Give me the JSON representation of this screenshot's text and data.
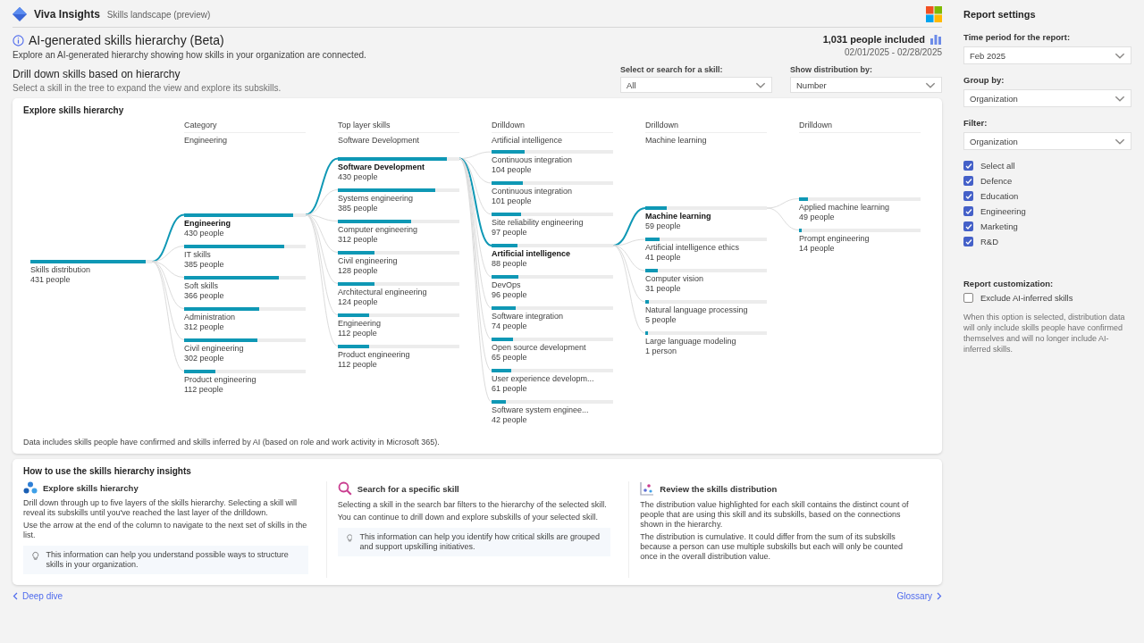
{
  "header": {
    "app_name": "Viva Insights",
    "page": "Skills landscape (preview)"
  },
  "title": "AI-generated skills hierarchy (Beta)",
  "description": "Explore an AI-generated hierarchy showing how skills in your organization are connected.",
  "people_included": "1,031 people included",
  "date_range": "02/01/2025 - 02/28/2025",
  "drilldown": {
    "title": "Drill down skills based on hierarchy",
    "hint": "Select a skill in the tree to expand the view and explore its subskills."
  },
  "filters": [
    {
      "label": "Select or search for a skill:",
      "value": "All"
    },
    {
      "label": "Show distribution by:",
      "value": "Number"
    }
  ],
  "hierarchy": {
    "title": "Explore skills hierarchy",
    "root": {
      "label": "Skills distribution",
      "count": "431 people",
      "level": 0.95
    },
    "columns": [
      {
        "header": "Category",
        "selection": "Engineering",
        "items": [
          {
            "label": "Engineering",
            "count": "430 people",
            "level": 0.9,
            "selected": true
          },
          {
            "label": "IT skills",
            "count": "385 people",
            "level": 0.82,
            "selected": false
          },
          {
            "label": "Soft skills",
            "count": "366 people",
            "level": 0.78,
            "selected": false
          },
          {
            "label": "Administration",
            "count": "312 people",
            "level": 0.62,
            "selected": false
          },
          {
            "label": "Civil engineering",
            "count": "302 people",
            "level": 0.6,
            "selected": false
          },
          {
            "label": "Product engineering",
            "count": "112 people",
            "level": 0.26,
            "selected": false
          }
        ]
      },
      {
        "header": "Top layer skills",
        "selection": "Software Development",
        "items": [
          {
            "label": "Software Development",
            "count": "430 people",
            "level": 0.9,
            "selected": true
          },
          {
            "label": "Systems engineering",
            "count": "385 people",
            "level": 0.8,
            "selected": false
          },
          {
            "label": "Computer engineering",
            "count": "312 people",
            "level": 0.6,
            "selected": false
          },
          {
            "label": "Civil engineering",
            "count": "128 people",
            "level": 0.3,
            "selected": false
          },
          {
            "label": "Architectural engineering",
            "count": "124 people",
            "level": 0.3,
            "selected": false
          },
          {
            "label": "Engineering",
            "count": "112 people",
            "level": 0.26,
            "selected": false
          },
          {
            "label": "Product engineering",
            "count": "112 people",
            "level": 0.26,
            "selected": false
          }
        ]
      },
      {
        "header": "Drilldown",
        "selection": "Artificial intelligence",
        "items": [
          {
            "label": "Continuous integration",
            "count": "104 people",
            "level": 0.27,
            "selected": false
          },
          {
            "label": "Continuous integration",
            "count": "101 people",
            "level": 0.26,
            "selected": false
          },
          {
            "label": "Site reliability engineering",
            "count": "97 people",
            "level": 0.24,
            "selected": false
          },
          {
            "label": "Artificial intelligence",
            "count": "88 people",
            "level": 0.21,
            "selected": true
          },
          {
            "label": "DevOps",
            "count": "96 people",
            "level": 0.22,
            "selected": false
          },
          {
            "label": "Software integration",
            "count": "74 people",
            "level": 0.2,
            "selected": false
          },
          {
            "label": "Open source development",
            "count": "65 people",
            "level": 0.18,
            "selected": false
          },
          {
            "label": "User experience developm...",
            "count": "61 people",
            "level": 0.16,
            "selected": false
          },
          {
            "label": "Software system enginee...",
            "count": "42 people",
            "level": 0.12,
            "selected": false
          }
        ]
      },
      {
        "header": "Drilldown",
        "selection": "Machine learning",
        "items": [
          {
            "label": "Machine learning",
            "count": "59 people",
            "level": 0.18,
            "selected": true
          },
          {
            "label": "Artificial intelligence ethics",
            "count": "41 people",
            "level": 0.12,
            "selected": false
          },
          {
            "label": "Computer vision",
            "count": "31 people",
            "level": 0.1,
            "selected": false
          },
          {
            "label": "Natural language processing",
            "count": "5 people",
            "level": 0.03,
            "selected": false
          },
          {
            "label": "Large language modeling",
            "count": "1 person",
            "level": 0.02,
            "selected": false
          }
        ]
      },
      {
        "header": "Drilldown",
        "items": [
          {
            "label": "Applied machine learning",
            "count": "49 people",
            "level": 0.07,
            "selected": false
          },
          {
            "label": "Prompt engineering",
            "count": "14 people",
            "level": 0.02,
            "selected": false
          }
        ]
      }
    ],
    "footnote": "Data includes skills people have confirmed and skills inferred by AI (based on role and work activity in Microsoft 365)."
  },
  "insights": {
    "title": "How to use the skills hierarchy insights",
    "sections": [
      {
        "kind": "hierarchy",
        "title": "Explore skills hierarchy",
        "paragraphs": [
          "Drill down through up to five layers of the skills hierarchy. Selecting a skill will reveal its subskills until you've reached the last layer of the drilldown.",
          "Use the arrow at the end of the column to navigate to the next set of skills in the list."
        ],
        "tip": "This information can help you understand possible ways to structure skills in your organization."
      },
      {
        "kind": "search",
        "title": "Search for a specific skill",
        "paragraphs": [
          "Selecting a skill in the search bar filters to the hierarchy of the selected skill.",
          "You can continue to drill down and explore subskills of your selected skill."
        ],
        "tip": "This information can help you identify how critical skills are grouped and support upskilling initiatives."
      },
      {
        "kind": "distribution",
        "title": "Review the skills distribution",
        "paragraphs": [
          "The distribution value highlighted for each skill contains the distinct count of people that are using this skill and its subskills, based on the connections shown in the hierarchy.",
          "The distribution is cumulative. It could differ from the sum of its subskills because a person can use multiple subskills but each will only be counted once in the overall distribution value."
        ]
      }
    ]
  },
  "nav": {
    "back": "Deep dive",
    "forward": "Glossary"
  },
  "settings": {
    "title": "Report settings",
    "dropdowns": [
      {
        "label": "Time period for the report:",
        "value": "Feb 2025"
      },
      {
        "label": "Group by:",
        "value": "Organization"
      },
      {
        "label": "Filter:",
        "value": "Organization"
      }
    ],
    "options": [
      {
        "label": "Select all",
        "checked": true
      },
      {
        "label": "Defence",
        "checked": true
      },
      {
        "label": "Education",
        "checked": true
      },
      {
        "label": "Engineering",
        "checked": true
      },
      {
        "label": "Marketing",
        "checked": true
      },
      {
        "label": "R&D",
        "checked": true
      }
    ],
    "customization_label": "Report customization:",
    "exclude": {
      "label": "Exclude AI-inferred skills",
      "checked": false
    },
    "note": "When this option is selected, distribution data will only include skills people have confirmed themselves and will no longer include AI-inferred skills."
  }
}
